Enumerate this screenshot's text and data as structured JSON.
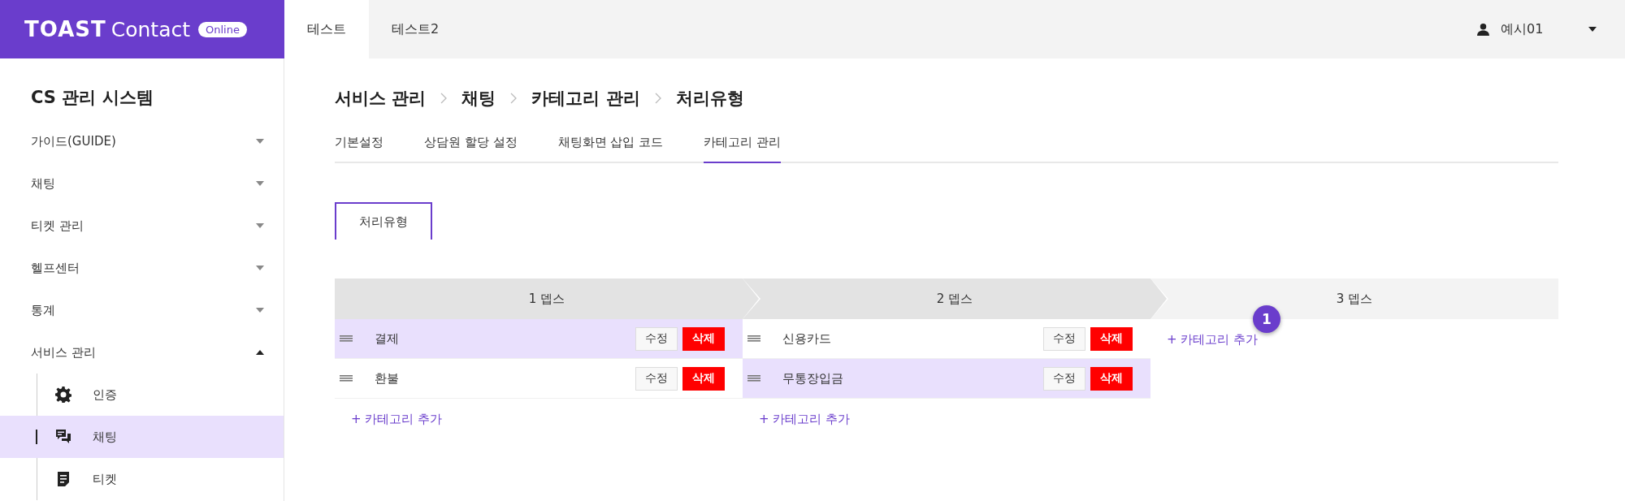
{
  "header": {
    "logo": "TOAST",
    "product": "Contact",
    "badge": "Online",
    "tabs": [
      {
        "label": "테스트",
        "selected": true
      },
      {
        "label": "테스트2",
        "selected": false
      }
    ],
    "user": "예시01"
  },
  "sidebar": {
    "title": "CS 관리 시스템",
    "items": [
      {
        "label": "가이드(GUIDE)",
        "expanded": false
      },
      {
        "label": "채팅",
        "expanded": false
      },
      {
        "label": "티켓 관리",
        "expanded": false
      },
      {
        "label": "헬프센터",
        "expanded": false
      },
      {
        "label": "통계",
        "expanded": false
      },
      {
        "label": "서비스 관리",
        "expanded": true,
        "children": [
          {
            "label": "인증",
            "kind": "gear",
            "selected": false
          },
          {
            "label": "채팅",
            "kind": "chat",
            "selected": true
          },
          {
            "label": "티켓",
            "kind": "document",
            "selected": false
          }
        ]
      }
    ]
  },
  "breadcrumb": [
    "서비스 관리",
    "채팅",
    "카테고리 관리",
    "처리유형"
  ],
  "tabs": [
    {
      "label": "기본설정",
      "selected": false
    },
    {
      "label": "상담원 할당 설정",
      "selected": false
    },
    {
      "label": "채팅화면 삽입 코드",
      "selected": false
    },
    {
      "label": "카테고리 관리",
      "selected": true
    }
  ],
  "subtab": {
    "label": "처리유형"
  },
  "columns": [
    {
      "header": "1 뎁스",
      "active": true,
      "rows": [
        {
          "label": "결제",
          "selected": true,
          "edit": "수정",
          "delete": "삭제"
        },
        {
          "label": "환불",
          "selected": false,
          "edit": "수정",
          "delete": "삭제"
        }
      ],
      "add": "+ 카테고리 추가"
    },
    {
      "header": "2 뎁스",
      "active": true,
      "rows": [
        {
          "label": "신용카드",
          "selected": false,
          "edit": "수정",
          "delete": "삭제"
        },
        {
          "label": "무통장입금",
          "selected": true,
          "edit": "수정",
          "delete": "삭제"
        }
      ],
      "add": "+ 카테고리 추가"
    },
    {
      "header": "3 뎁스",
      "active": false,
      "add": "+ 카테고리 추가"
    }
  ],
  "step_badge": "1"
}
